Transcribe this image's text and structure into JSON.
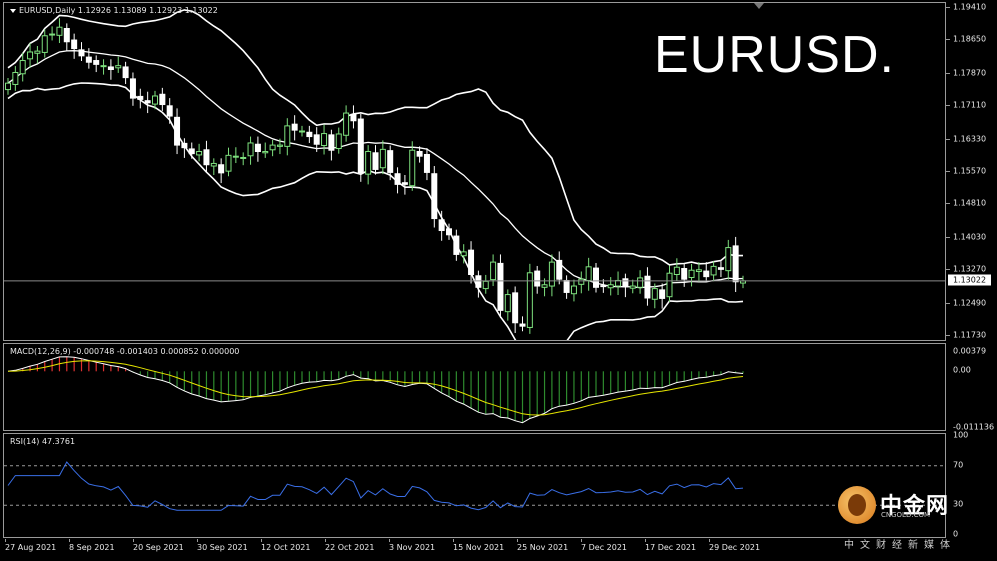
{
  "main": {
    "menu_icon": "triangle-down-icon",
    "info": "EURUSD,Daily  1.12926 1.13089 1.12923 1.13022",
    "big_title": "EURUSD.",
    "price_ticks": [
      "1.19410",
      "1.18650",
      "1.17870",
      "1.17110",
      "1.16330",
      "1.15570",
      "1.14810",
      "1.14030",
      "1.13270",
      "1.12490",
      "1.11730"
    ],
    "current_price": "1.13022"
  },
  "macd": {
    "info": "MACD(12,26,9) -0.000748 -0.001403 0.000852 0.000000",
    "ticks": [
      "0.00379",
      "0.00",
      "-0.011136"
    ]
  },
  "rsi": {
    "info": "RSI(14) 47.3761",
    "ticks": [
      "100",
      "70",
      "30",
      "0"
    ]
  },
  "xaxis": {
    "labels": [
      "27 Aug 2021",
      "8 Sep 2021",
      "20 Sep 2021",
      "30 Sep 2021",
      "12 Oct 2021",
      "22 Oct 2021",
      "3 Nov 2021",
      "15 Nov 2021",
      "25 Nov 2021",
      "7 Dec 2021",
      "17 Dec 2021",
      "29 Dec 2021"
    ]
  },
  "logo": {
    "cn": "中金网",
    "url": "CNGOLD.COM",
    "sub": "中文财经新媒体"
  },
  "colors": {
    "bull": "#7ee07e",
    "bear": "#ffffff",
    "bands": "#ffffff",
    "macd_pos": "#e03030",
    "macd_neg": "#2e8b2e",
    "macd_signal": "#e6e600",
    "rsi": "#3a6fe8"
  },
  "chart_data": {
    "type": "candlestick",
    "symbol": "EURUSD",
    "timeframe": "Daily",
    "ohlc_last": {
      "open": 1.12926,
      "high": 1.13089,
      "low": 1.12923,
      "close": 1.13022
    },
    "ylim": [
      1.1173,
      1.1941
    ],
    "closes": [
      1.1765,
      1.179,
      1.1818,
      1.1838,
      1.184,
      1.1876,
      1.188,
      1.1896,
      1.1862,
      1.1846,
      1.1829,
      1.1814,
      1.1809,
      1.1806,
      1.1797,
      1.1806,
      1.1778,
      1.173,
      1.1727,
      1.1719,
      1.1735,
      1.1715,
      1.1688,
      1.162,
      1.1614,
      1.16,
      1.1605,
      1.1574,
      1.1577,
      1.1555,
      1.1596,
      1.1594,
      1.1591,
      1.1625,
      1.1605,
      1.1605,
      1.162,
      1.162,
      1.1665,
      1.1655,
      1.1653,
      1.164,
      1.1622,
      1.1647,
      1.1608,
      1.1646,
      1.1695,
      1.1677,
      1.1555,
      1.1605,
      1.1563,
      1.161,
      1.1556,
      1.1528,
      1.1528,
      1.1608,
      1.1594,
      1.1556,
      1.1448,
      1.142,
      1.141,
      1.1364,
      1.137,
      1.1317,
      1.1287,
      1.1301,
      1.1346,
      1.1233,
      1.127,
      1.1204,
      1.1196,
      1.1321,
      1.129,
      1.1293,
      1.1346,
      1.1306,
      1.1275,
      1.129,
      1.1306,
      1.1335,
      1.1287,
      1.1289,
      1.1293,
      1.1303,
      1.1288,
      1.129,
      1.1309,
      1.1262,
      1.1284,
      1.1261,
      1.132,
      1.1334,
      1.1306,
      1.1327,
      1.1328,
      1.1312,
      1.1336,
      1.1329,
      1.138,
      1.13,
      1.1302
    ],
    "macd_range": [
      -0.011136,
      0.00379
    ],
    "rsi_levels": [
      70,
      30
    ],
    "rsi_last": 47.3761
  }
}
